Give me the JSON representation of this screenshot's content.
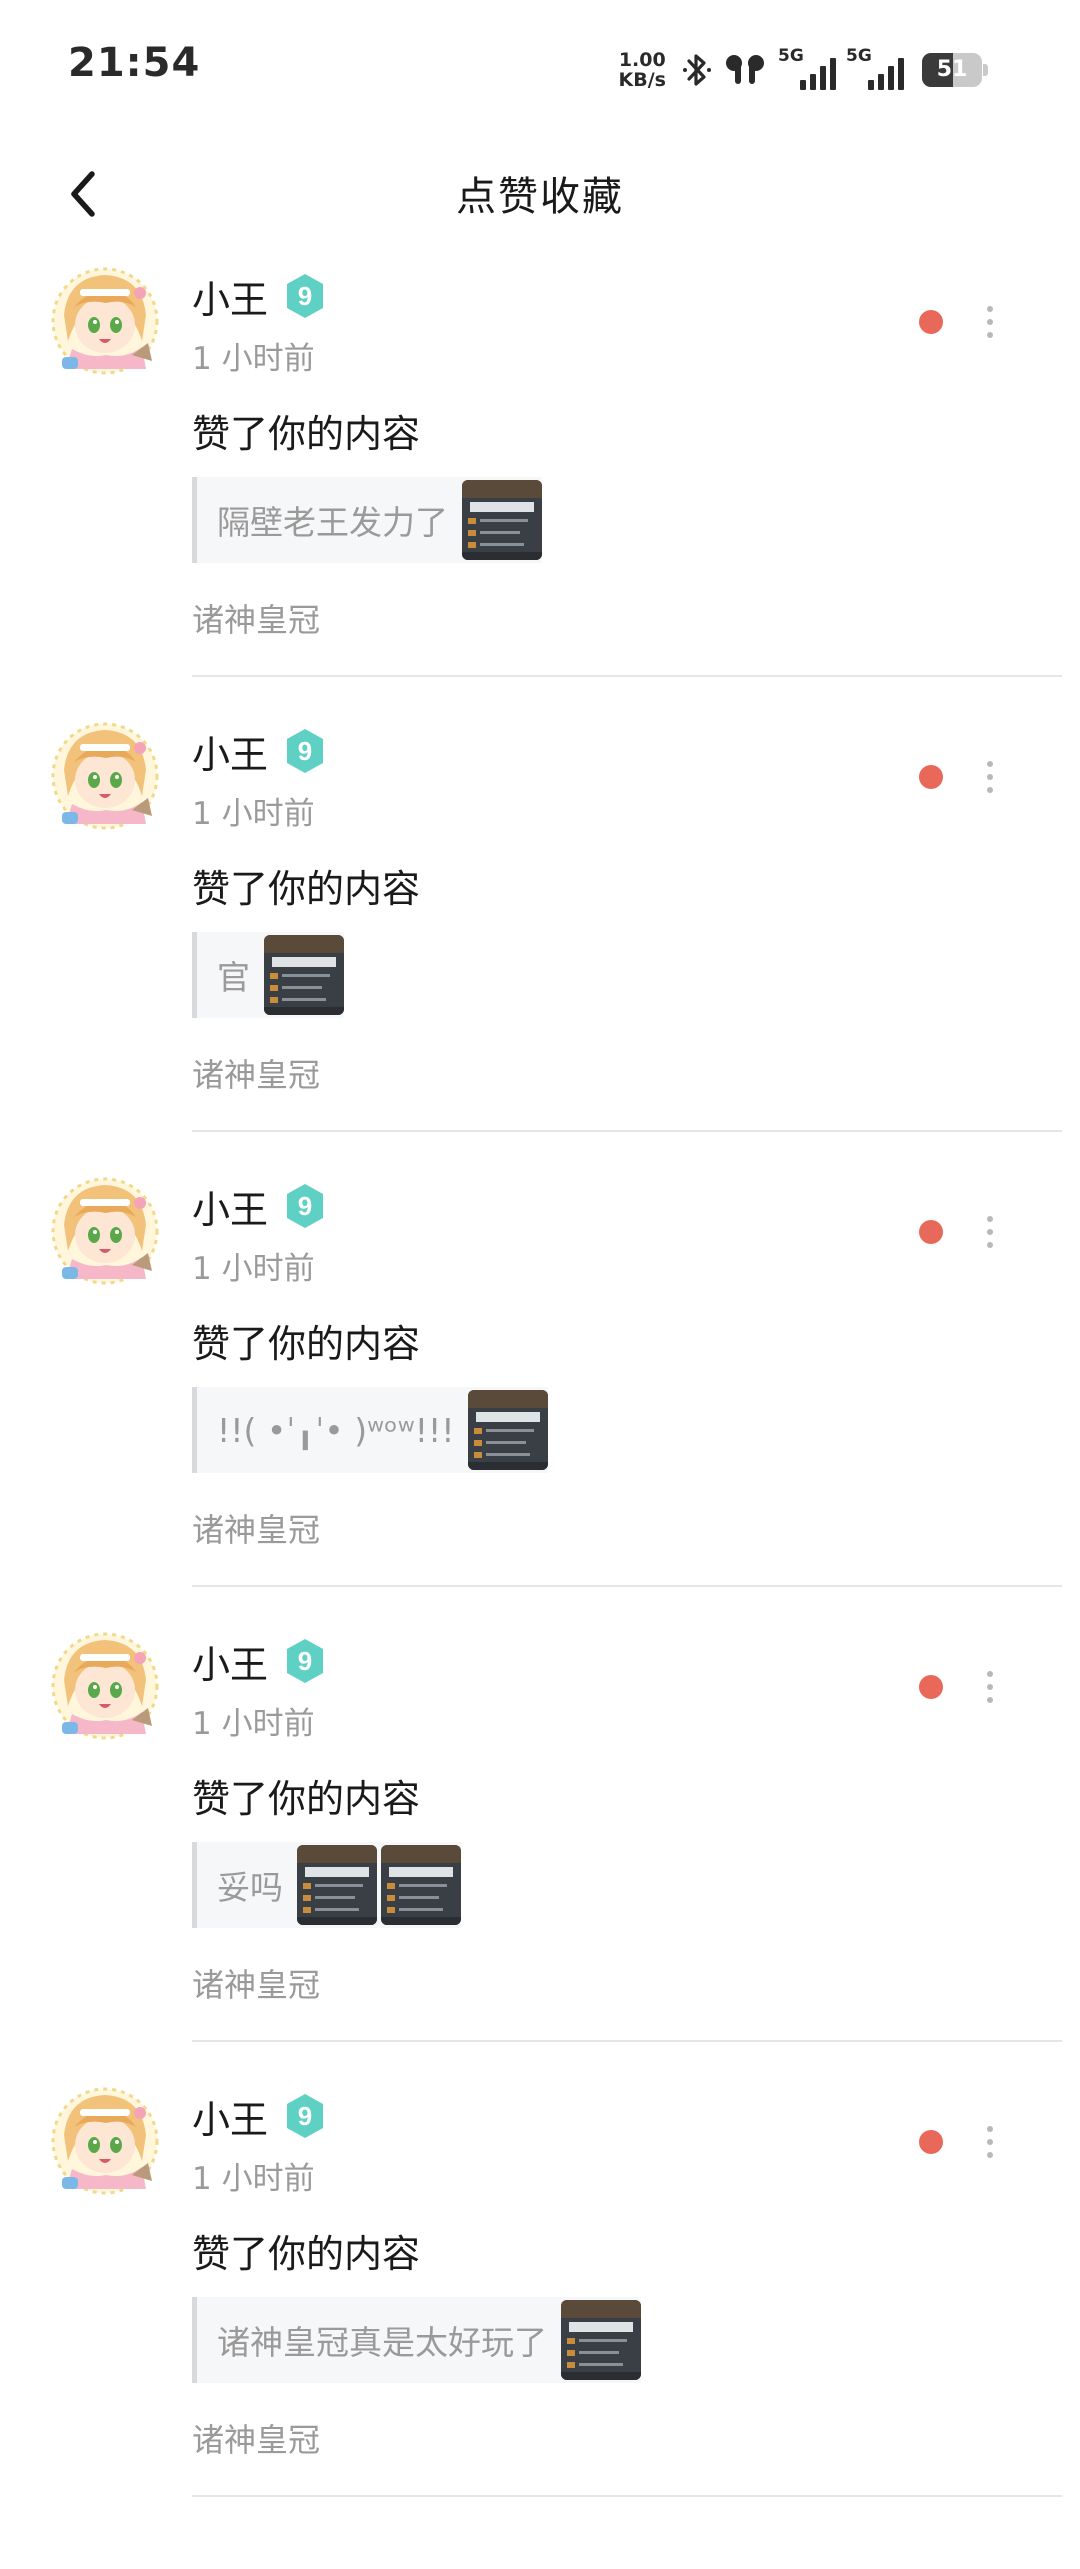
{
  "status_bar": {
    "time": "21:54",
    "net_speed_value": "1.00",
    "net_speed_unit": "KB/s",
    "signal_1_label": "5G",
    "signal_2_label": "5G",
    "battery_level": "51",
    "battery_fraction": 0.51
  },
  "header": {
    "title": "点赞收藏",
    "back_icon": "chevron-left-icon"
  },
  "colors": {
    "unread_dot": "#e8685a",
    "badge": "#5fd0c4"
  },
  "notifications": [
    {
      "user": "小王",
      "level": "9",
      "time": "1 小时前",
      "action": "赞了你的内容",
      "quote": "隔壁老王发力了",
      "thumbnails": 1,
      "game": "诸神皇冠",
      "unread": true
    },
    {
      "user": "小王",
      "level": "9",
      "time": "1 小时前",
      "action": "赞了你的内容",
      "quote": "官",
      "thumbnails": 1,
      "game": "诸神皇冠",
      "unread": true
    },
    {
      "user": "小王",
      "level": "9",
      "time": "1 小时前",
      "action": "赞了你的内容",
      "quote": "!!( •ˈ╻ˈ• )ʷᵒʷ!!!",
      "thumbnails": 1,
      "game": "诸神皇冠",
      "unread": true
    },
    {
      "user": "小王",
      "level": "9",
      "time": "1 小时前",
      "action": "赞了你的内容",
      "quote": "妥吗",
      "thumbnails": 2,
      "game": "诸神皇冠",
      "unread": true
    },
    {
      "user": "小王",
      "level": "9",
      "time": "1 小时前",
      "action": "赞了你的内容",
      "quote": "诸神皇冠真是太好玩了",
      "thumbnails": 1,
      "game": "诸神皇冠",
      "unread": true
    }
  ]
}
